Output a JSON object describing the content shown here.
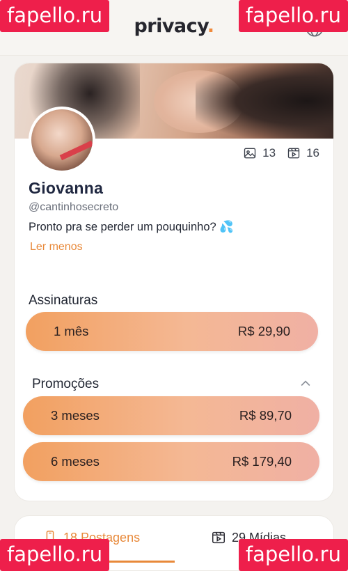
{
  "watermark": "fapello.ru",
  "header": {
    "logo_text": "privacy",
    "logo_dot": ".",
    "accent_color": "#f08a3c",
    "globe_icon": "globe-icon"
  },
  "profile": {
    "name": "Giovanna",
    "handle": "@cantinhosecreto",
    "bio": "Pronto pra se perder um pouquinho?",
    "bio_emoji": "💦",
    "read_less": "Ler menos",
    "stats": {
      "images": "13",
      "videos": "16"
    }
  },
  "subscriptions": {
    "title": "Assinaturas",
    "plans": [
      {
        "label": "1 mês",
        "price": "R$ 29,90"
      }
    ]
  },
  "promotions": {
    "title": "Promoções",
    "plans": [
      {
        "label": "3 meses",
        "price": "R$ 89,70"
      },
      {
        "label": "6 meses",
        "price": "R$ 179,40"
      }
    ]
  },
  "tabs": [
    {
      "label": "18 Postagens",
      "active": true
    },
    {
      "label": "29 Mídias",
      "active": false
    }
  ]
}
